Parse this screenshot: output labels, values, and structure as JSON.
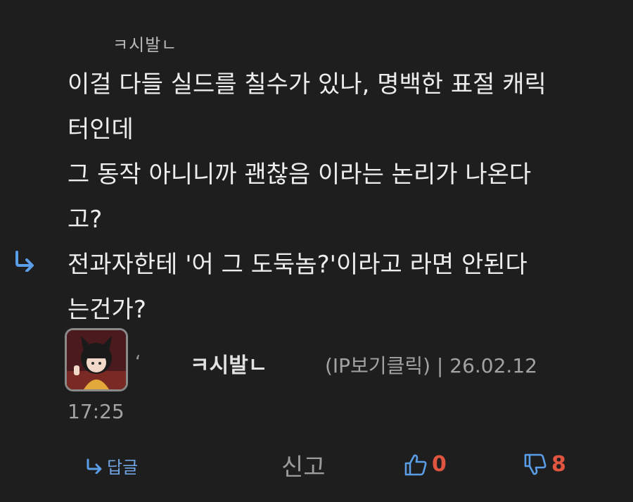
{
  "comment": {
    "quoted_ref": "ㅋ시발ㄴ",
    "lines": [
      "이걸 다들 실드를 칠수가 있나, 명백한 표절 캐릭",
      "터인데",
      "그 동작 아니니까 괜찮음 이라는 논리가 나온다",
      "고?",
      "전과자한테 '어 그 도둑놈?'이라고 라면 안된다",
      "는건가?"
    ]
  },
  "meta": {
    "author": "ㅋ시발ㄴ",
    "ip_date": "(IP보기클릭) | 26.02.12",
    "time": "17:25"
  },
  "actions": {
    "reply_label": "답글",
    "report_label": "신고",
    "upvote_count": "0",
    "downvote_count": "8"
  },
  "colors": {
    "background": "#1e1e1e",
    "text": "#ededed",
    "accent_blue": "#5b9ee8",
    "vote_red": "#e0553f"
  },
  "icons": [
    "reply-arrow-icon",
    "thumbs-up-icon",
    "thumbs-down-icon"
  ]
}
